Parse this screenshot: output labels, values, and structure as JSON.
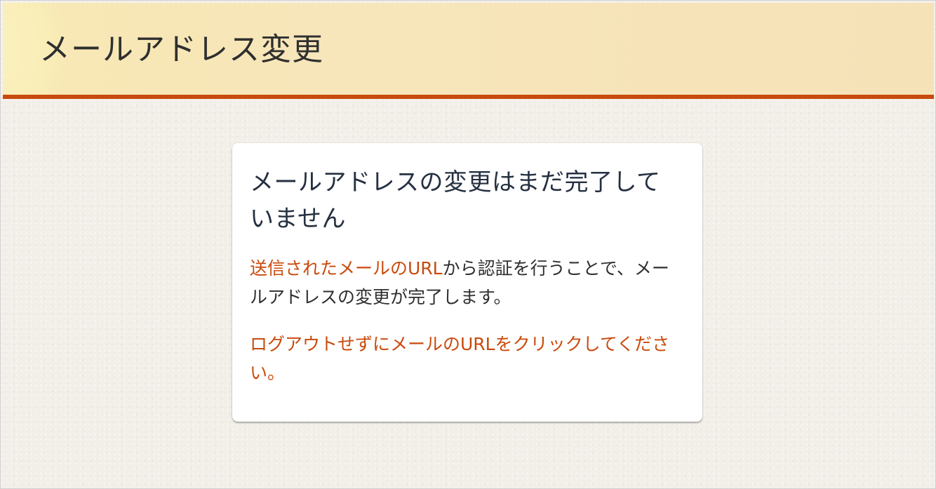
{
  "page": {
    "title": "メールアドレス変更"
  },
  "card": {
    "heading": "メールアドレスの変更はまだ完了していません",
    "message_highlight": "送信されたメールのURL",
    "message_rest": "から認証を行うことで、メールアドレスの変更が完了します。",
    "note": "ログアウトせずにメールのURLをクリックしてください。"
  },
  "colors": {
    "accent": "#c94a0c",
    "header_bg": "#f7e6ba",
    "page_bg": "#f2efe9",
    "heading_text": "#253041"
  }
}
